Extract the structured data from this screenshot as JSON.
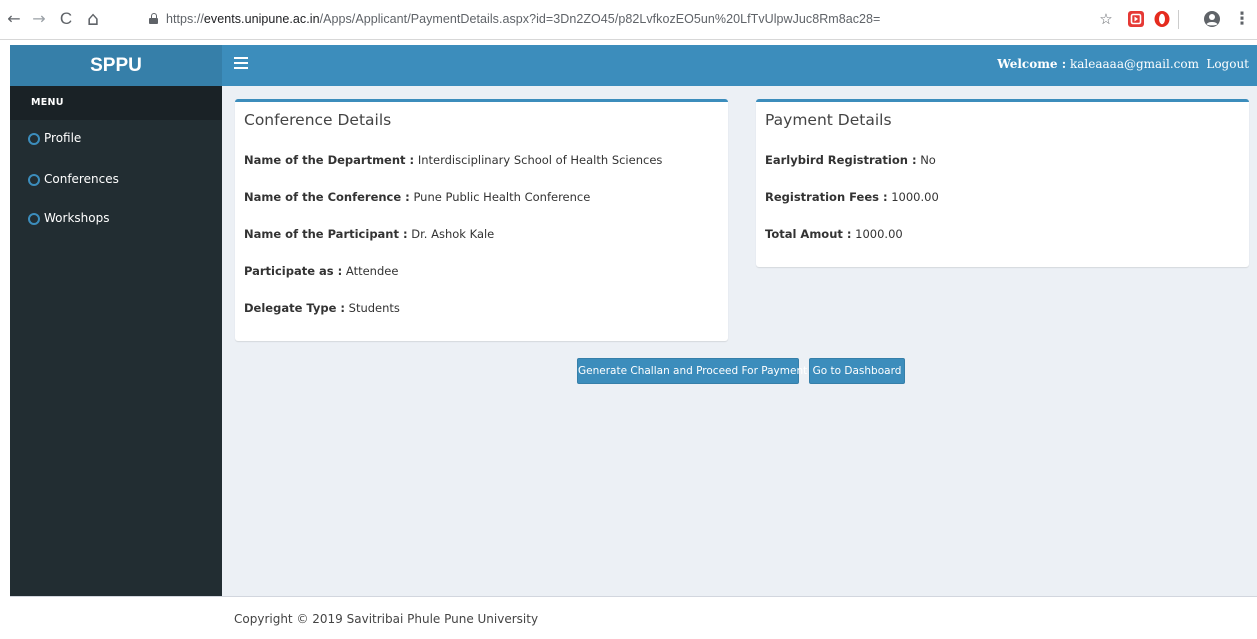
{
  "browser": {
    "url_scheme": "https://",
    "url_host": "events.unipune.ac.in",
    "url_path": "/Apps/Applicant/PaymentDetails.aspx?id=3Dn2ZO45/p82LvfkozEO5un%20LfTvUlpwJuc8Rm8ac28=",
    "back_glyph": "←",
    "forward_glyph": "→",
    "reload_glyph": "C",
    "home_glyph": "⌂",
    "star_glyph": "☆",
    "menu_glyph": "⋮"
  },
  "header": {
    "brand": "SPPU",
    "welcome_label": "Welcome :",
    "welcome_email": "kaleaaaa@gmail.com",
    "logout": "Logout"
  },
  "sidebar": {
    "menu_header": "MENU",
    "items": [
      {
        "label": "Profile",
        "icon": "circle-icon"
      },
      {
        "label": "Conferences",
        "icon": "circle-icon"
      },
      {
        "label": "Workshops",
        "icon": "circle-icon"
      }
    ]
  },
  "conference": {
    "title": "Conference Details",
    "rows": [
      {
        "label": "Name of the Department :",
        "value": "Interdisciplinary School of Health Sciences"
      },
      {
        "label": "Name of the Conference :",
        "value": "Pune Public Health Conference"
      },
      {
        "label": "Name of the Participant :",
        "value": "Dr. Ashok Kale"
      },
      {
        "label": "Participate as :",
        "value": "Attendee"
      },
      {
        "label": "Delegate Type :",
        "value": "Students"
      }
    ]
  },
  "payment": {
    "title": "Payment Details",
    "rows": [
      {
        "label": "Earlybird Registration :",
        "value": "No"
      },
      {
        "label": "Registration Fees :",
        "value": "1000.00"
      },
      {
        "label": "Total Amout :",
        "value": "1000.00"
      }
    ]
  },
  "actions": {
    "generate_challan": "Generate Challan and Proceed For Payment",
    "dashboard": "Go to Dashboard"
  },
  "footer": {
    "copyright": "Copyright ©  2019   Savitribai Phule Pune University"
  },
  "colors": {
    "primary": "#3c8dbc",
    "brand_bg": "#367fa9",
    "sidebar_bg": "#222d32",
    "content_bg": "#ecf0f5"
  }
}
